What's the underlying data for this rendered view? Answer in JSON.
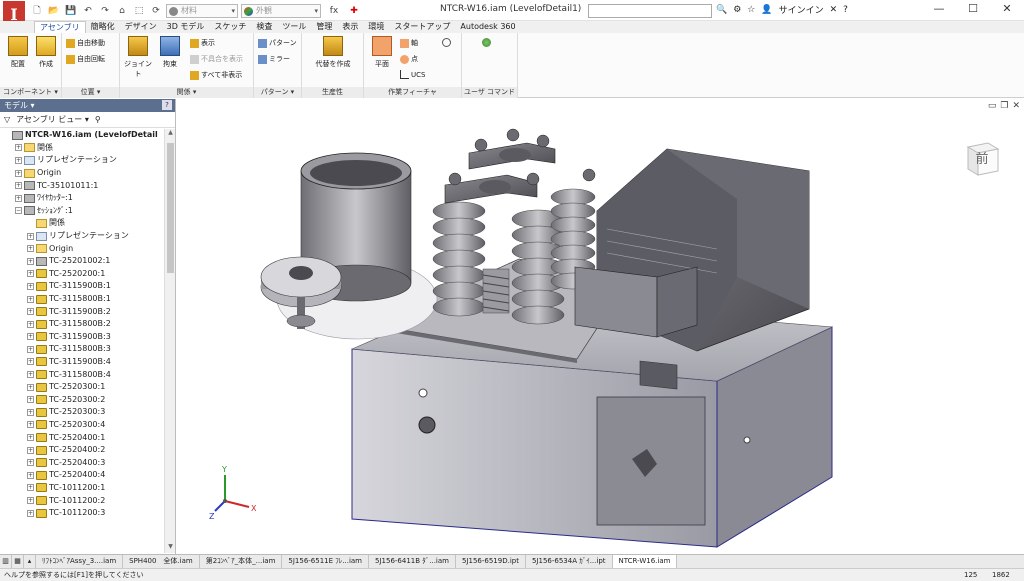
{
  "app": {
    "logo_letter": "I",
    "accent": "#c8382e"
  },
  "titlebar": {
    "title": "NTCR-W16.iam (LevelofDetail1)",
    "material_placeholder": "材料",
    "appearance_placeholder": "外観",
    "signin": "サインイン",
    "fx_label": "fx",
    "window_minimize": "—",
    "window_maximize": "☐",
    "window_close": "✕"
  },
  "tabs": [
    "アセンブリ",
    "簡略化",
    "デザイン",
    "3D モデル",
    "スケッチ",
    "検査",
    "ツール",
    "管理",
    "表示",
    "環境",
    "スタートアップ",
    "Autodesk 360"
  ],
  "active_tab": 0,
  "ribbon": {
    "panels": {
      "component": {
        "footer": "コンポーネント ▾",
        "place": "配置",
        "create": "作成"
      },
      "position": {
        "footer": "位置 ▾",
        "free_move": "自由移動",
        "free_rotate": "自由回転"
      },
      "relation": {
        "footer": "関係 ▾",
        "joint": "ジョイント",
        "constrain": "拘束",
        "show": "表示",
        "show_problems": "不具合を表示",
        "hide_all": "すべて非表示"
      },
      "pattern": {
        "footer": "パターン ▾",
        "pattern": "パターン",
        "mirror": "ミラー"
      },
      "productivity": {
        "footer": "生産性",
        "substitute": "代替を作成"
      },
      "work_features": {
        "footer": "作業フィーチャ",
        "plane": "平面",
        "axis": "軸",
        "point": "点",
        "ucs": "UCS"
      },
      "user_commands": {
        "footer": "ユーザ コマンド"
      }
    }
  },
  "browser": {
    "title": "モデル ▾",
    "close": "?",
    "view_label": "アセンブリ ビュー ▾",
    "items": [
      {
        "label": "NTCR-W16.iam (LevelofDetail",
        "level": 0,
        "icon": "asm",
        "exp": ""
      },
      {
        "label": "関係",
        "level": 1,
        "icon": "folder",
        "exp": "+"
      },
      {
        "label": "リプレゼンテーション",
        "level": 1,
        "icon": "rep",
        "exp": "+"
      },
      {
        "label": "Origin",
        "level": 1,
        "icon": "folder",
        "exp": "+"
      },
      {
        "label": "TC-35101011:1",
        "level": 1,
        "icon": "asm",
        "exp": "+"
      },
      {
        "label": "ﾜｲﾔｶｯﾀｰ:1",
        "level": 1,
        "icon": "asm",
        "exp": "+"
      },
      {
        "label": "ｾｯｼｮﾝｸﾞ:1",
        "level": 1,
        "icon": "asm",
        "exp": "−"
      },
      {
        "label": "関係",
        "level": 2,
        "icon": "folder",
        "exp": ""
      },
      {
        "label": "リプレゼンテーション",
        "level": 2,
        "icon": "rep",
        "exp": "+"
      },
      {
        "label": "Origin",
        "level": 2,
        "icon": "folder",
        "exp": "+"
      },
      {
        "label": "TC-25201002:1",
        "level": 2,
        "icon": "asm",
        "exp": "+"
      },
      {
        "label": "TC-2520200:1",
        "level": 2,
        "icon": "part",
        "exp": "+"
      },
      {
        "label": "TC-3115900B:1",
        "level": 2,
        "icon": "part",
        "exp": "+"
      },
      {
        "label": "TC-3115800B:1",
        "level": 2,
        "icon": "part",
        "exp": "+"
      },
      {
        "label": "TC-3115900B:2",
        "level": 2,
        "icon": "part",
        "exp": "+"
      },
      {
        "label": "TC-3115800B:2",
        "level": 2,
        "icon": "part",
        "exp": "+"
      },
      {
        "label": "TC-3115900B:3",
        "level": 2,
        "icon": "part",
        "exp": "+"
      },
      {
        "label": "TC-3115800B:3",
        "level": 2,
        "icon": "part",
        "exp": "+"
      },
      {
        "label": "TC-3115900B:4",
        "level": 2,
        "icon": "part",
        "exp": "+"
      },
      {
        "label": "TC-3115800B:4",
        "level": 2,
        "icon": "part",
        "exp": "+"
      },
      {
        "label": "TC-2520300:1",
        "level": 2,
        "icon": "part",
        "exp": "+"
      },
      {
        "label": "TC-2520300:2",
        "level": 2,
        "icon": "part",
        "exp": "+"
      },
      {
        "label": "TC-2520300:3",
        "level": 2,
        "icon": "part",
        "exp": "+"
      },
      {
        "label": "TC-2520300:4",
        "level": 2,
        "icon": "part",
        "exp": "+"
      },
      {
        "label": "TC-2520400:1",
        "level": 2,
        "icon": "part",
        "exp": "+"
      },
      {
        "label": "TC-2520400:2",
        "level": 2,
        "icon": "part",
        "exp": "+"
      },
      {
        "label": "TC-2520400:3",
        "level": 2,
        "icon": "part",
        "exp": "+"
      },
      {
        "label": "TC-2520400:4",
        "level": 2,
        "icon": "part",
        "exp": "+"
      },
      {
        "label": "TC-1011200:1",
        "level": 2,
        "icon": "part",
        "exp": "+"
      },
      {
        "label": "TC-1011200:2",
        "level": 2,
        "icon": "part",
        "exp": "+"
      },
      {
        "label": "TC-1011200:3",
        "level": 2,
        "icon": "part",
        "exp": "+"
      }
    ]
  },
  "viewport": {
    "viewcube_face": "前",
    "axis_x": "X",
    "axis_y": "Y",
    "axis_z": "Z"
  },
  "doc_tabs": [
    {
      "label": "ﾘﾌﾄｺﾝﾍﾞｱAssy_3....iam",
      "active": false
    },
    {
      "label": "SPH400　全体.iam",
      "active": false
    },
    {
      "label": "第2ｺﾝﾍﾞｱ_本体_...iam",
      "active": false
    },
    {
      "label": "5J156-6511E ﾌﾚ...iam",
      "active": false
    },
    {
      "label": "5J156-6411B ﾀﾞ...iam",
      "active": false
    },
    {
      "label": "5J156-6519D.ipt",
      "active": false
    },
    {
      "label": "5J156-6534A ｶﾞｲ...ipt",
      "active": false
    },
    {
      "label": "NTCR-W16.iam",
      "active": true
    }
  ],
  "statusbar": {
    "message": "ヘルプを参照するには[F1]を押してください",
    "count1": "125",
    "count2": "1862"
  }
}
